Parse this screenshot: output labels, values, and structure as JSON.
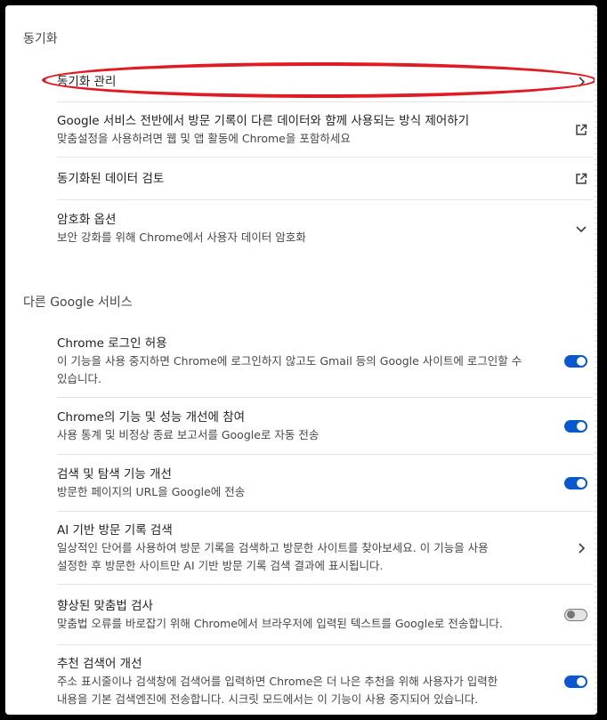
{
  "sync_section": {
    "title": "동기화",
    "items": [
      {
        "label": "동기화 관리"
      },
      {
        "label": "Google 서비스 전반에서 방문 기록이 다른 데이터와 함께 사용되는 방식 제어하기",
        "desc": "맞춤설정을 사용하려면 웹 및 앱 활동에 Chrome을 포함하세요"
      },
      {
        "label": "동기화된 데이터 검토"
      },
      {
        "label": "암호화 옵션",
        "desc": "보안 강화를 위해 Chrome에서 사용자 데이터 암호화"
      }
    ]
  },
  "google_section": {
    "title": "다른 Google 서비스",
    "items": [
      {
        "label": "Chrome 로그인 허용",
        "desc1": "이 기능을 사용 중지하면 Chrome에 로그인하지 않고도 Gmail 등의 Google 사이트에 로그인할 수",
        "desc2": "있습니다.",
        "enabled": true
      },
      {
        "label": "Chrome의 기능 및 성능 개선에 참여",
        "desc": "사용 통계 및 비정상 종료 보고서를 Google로 자동 전송",
        "enabled": true
      },
      {
        "label": "검색 및 탐색 기능 개선",
        "desc": "방문한 페이지의 URL을 Google에 전송",
        "enabled": true
      },
      {
        "label": "AI 기반 방문 기록 검색",
        "desc1": "일상적인 단어를 사용하여 방문 기록을 검색하고 방문한 사이트를 찾아보세요. 이 기능을 사용",
        "desc2": "설정한 후 방문한 사이트만 AI 기반 방문 기록 검색 결과에 표시됩니다."
      },
      {
        "label": "향상된 맞춤법 검사",
        "desc": "맞춤법 오류를 바로잡기 위해 Chrome에서 브라우저에 입력된 텍스트를 Google로 전송합니다.",
        "enabled": false
      },
      {
        "label": "추천 검색어 개선",
        "desc1": "주소 표시줄이나 검색창에 검색어를 입력하면 Chrome은 더 나은 추천을 위해 사용자가 입력한",
        "desc2": "내용을 기본 검색엔진에 전송합니다. 시크릿 모드에서는 이 기능이 사용 중지되어 있습니다.",
        "enabled": true
      }
    ]
  },
  "colors": {
    "accent": "#0b57d0",
    "annotation": "#e01b24"
  },
  "icons": [
    "chevron-right-icon",
    "external-link-icon",
    "chevron-down-icon"
  ]
}
